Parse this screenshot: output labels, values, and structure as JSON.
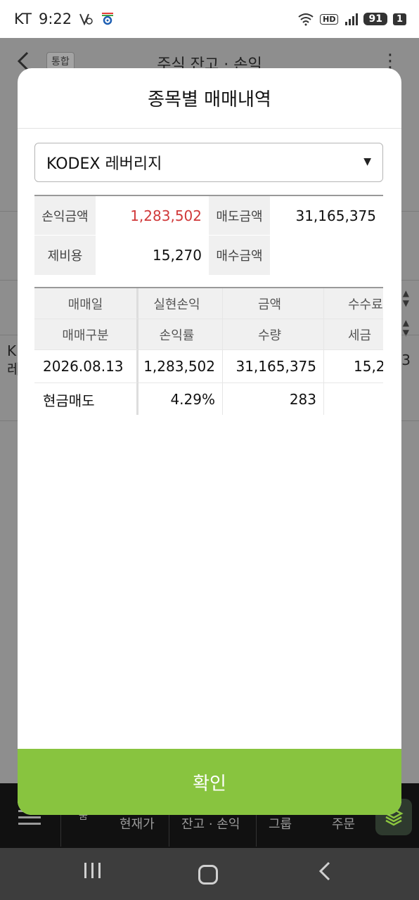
{
  "status_bar": {
    "carrier": "KT",
    "time": "9:22",
    "hd_label": "HD",
    "battery": "91",
    "sim": "1"
  },
  "background": {
    "back_icon": "chevron-left-icon",
    "badge": "통합",
    "title": "주식 잔고 · 손익",
    "more_icon": "more-vertical-icon",
    "left_text": "K\n레",
    "right_text": "3",
    "tabs": [
      "잔고 · 손익",
      "현재가",
      "그룹",
      "주문"
    ],
    "tab_small": "뭄"
  },
  "modal": {
    "title": "종목별 매매내역",
    "selected_stock": "KODEX 레버리지",
    "summary": {
      "profit_label": "손익금액",
      "profit_value": "1,283,502",
      "sell_amount_label": "매도금액",
      "sell_amount_value": "31,165,375",
      "fee_label": "제비용",
      "fee_value": "15,270",
      "buy_amount_label": "매수금액",
      "buy_amount_value": ""
    },
    "table": {
      "headers_row1": [
        "매매일",
        "실현손익",
        "금액",
        "수수료"
      ],
      "headers_row2": [
        "매매구분",
        "손익률",
        "수량",
        "세금"
      ],
      "rows": [
        {
          "line1": [
            "2026.08.13",
            "1,283,502",
            "31,165,375",
            "15,2"
          ],
          "line2": [
            "현금매도",
            "4.29%",
            "283",
            ""
          ]
        }
      ]
    },
    "confirm_label": "확인"
  }
}
